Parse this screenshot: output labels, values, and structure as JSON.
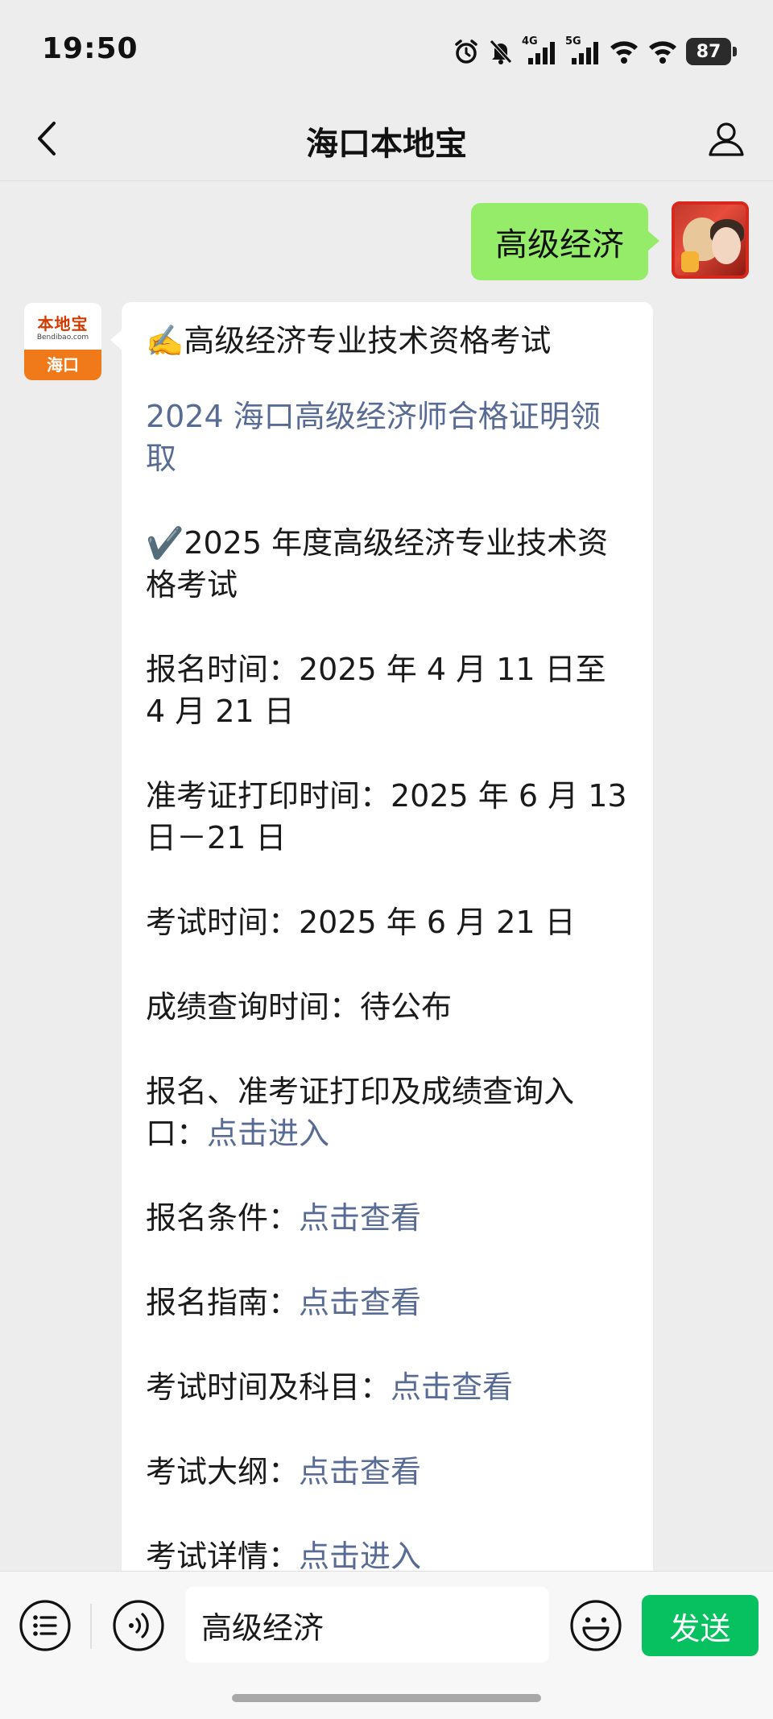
{
  "status_bar": {
    "time": "19:50",
    "net1": "4G",
    "net2": "5G",
    "battery": "87"
  },
  "nav": {
    "title": "海口本地宝"
  },
  "chat": {
    "user_message": "高级经济",
    "bot_avatar": {
      "logo_text": "本地宝",
      "logo_sub": "Bendibao.com",
      "city": "海口"
    },
    "bot_message": {
      "heading": "✍️高级经济专业技术资格考试",
      "link_2024": "2024 海口高级经济师合格证明领取",
      "subheading": "✔️2025 年度高级经济专业技术资格考试",
      "registration_time": "报名时间：2025 年 4 月 11 日至 4 月 21 日",
      "admission_print_time": "准考证打印时间：2025 年 6 月 13 日－21 日",
      "exam_time": "考试时间：2025 年 6 月 21 日",
      "score_query_time": "成绩查询时间：待公布",
      "entry_label": "报名、准考证打印及成绩查询入口：",
      "entry_link": "点击进入",
      "conditions_label": "报名条件：",
      "conditions_link": "点击查看",
      "guide_label": "报名指南：",
      "guide_link": "点击查看",
      "subjects_label": "考试时间及科目：",
      "subjects_link": "点击查看",
      "syllabus_label": "考试大纲：",
      "syllabus_link": "点击查看",
      "details_label": "考试详情：",
      "details_link": "点击进入"
    }
  },
  "input_bar": {
    "input_value": "高级经济",
    "send_label": "发送"
  },
  "colors": {
    "user_bubble": "#95ec69",
    "send_button": "#07c160",
    "link": "#576b95",
    "background": "#ededed"
  }
}
